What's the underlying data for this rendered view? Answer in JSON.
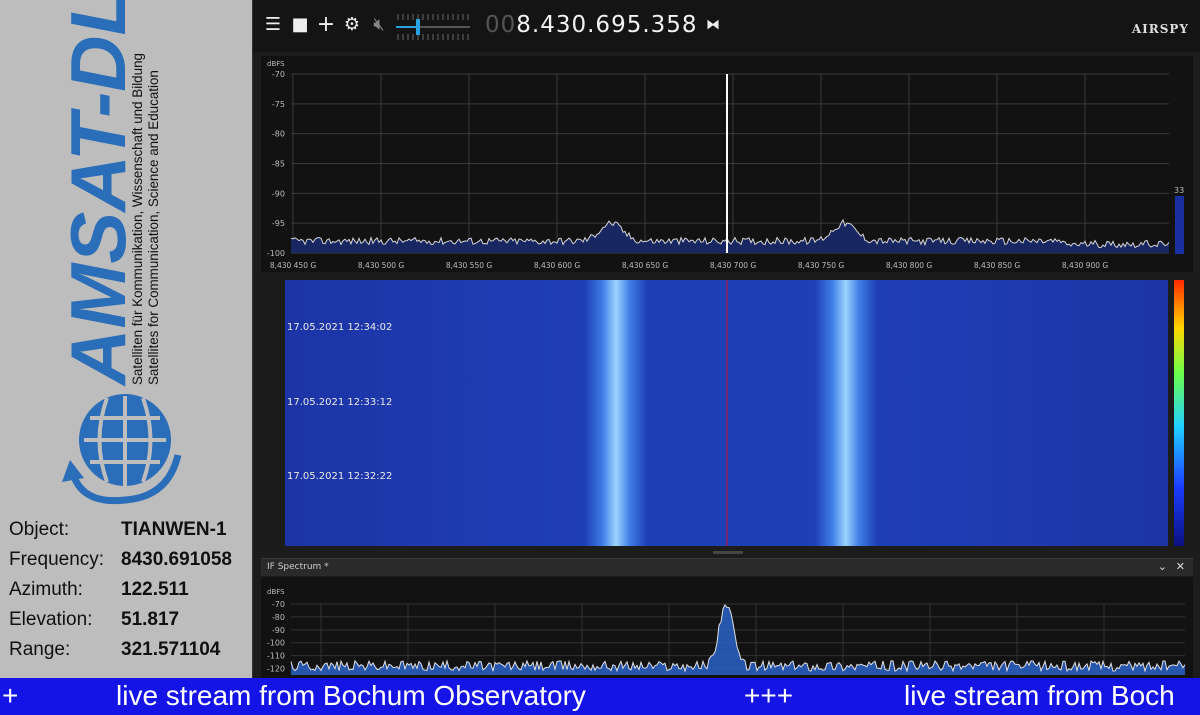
{
  "branding": {
    "logo_text": "AMSAT-DL",
    "tagline_de": "Satelliten für Kommunikation, Wissenschaft und Bildung",
    "tagline_en": "Satellites for Communication, Science and Education"
  },
  "info": [
    {
      "label": "Object:",
      "value": "TIANWEN-1"
    },
    {
      "label": "Frequency:",
      "value": "8430.691058"
    },
    {
      "label": "Azimuth:",
      "value": "122.511"
    },
    {
      "label": "Elevation:",
      "value": "51.817"
    },
    {
      "label": "Range:",
      "value": "321.571104"
    }
  ],
  "toolbar": {
    "freq_lead": "00",
    "freq_main": "8.430.695.358",
    "brand": "AIRSPY",
    "volume_level": 0.3
  },
  "spectrum": {
    "unit": "dBFS",
    "y_ticks": [
      "-70",
      "-75",
      "-80",
      "-85",
      "-90",
      "-95",
      "-100"
    ],
    "x_ticks": [
      "8,430 450 G",
      "8,430 500 G",
      "8,430 550 G",
      "8,430 600 G",
      "8,430 650 G",
      "8,430 700 G",
      "8,430 750 G",
      "8,430 800 G",
      "8,430 850 G",
      "8,430 900 G"
    ],
    "side_value": "33",
    "noise_floor_db": -98,
    "peaks": [
      {
        "freq_label": "8,430 630 G",
        "level_db": -95
      },
      {
        "freq_label": "8,430 757 G",
        "level_db": -95
      }
    ]
  },
  "waterfall": {
    "timestamps": [
      "17.05.2021 12:34:02",
      "17.05.2021 12:33:12",
      "17.05.2021 12:32:22"
    ]
  },
  "if_spectrum": {
    "title": "IF Spectrum *",
    "unit": "dBFS",
    "y_ticks": [
      "-70",
      "-80",
      "-90",
      "-100",
      "-110",
      "-120"
    ],
    "peak_db": -70
  },
  "ticker": {
    "items": [
      "+",
      "live stream from Bochum Observatory",
      "+++",
      "live stream from Boch"
    ]
  },
  "colors": {
    "waterfall_bg": "#1e3fb0",
    "ticker_bg": "#1414e6",
    "spectrum_fill": "#1a2a6a",
    "left_panel": "#bdbdbd",
    "logo_blue": "#2a6db8"
  }
}
